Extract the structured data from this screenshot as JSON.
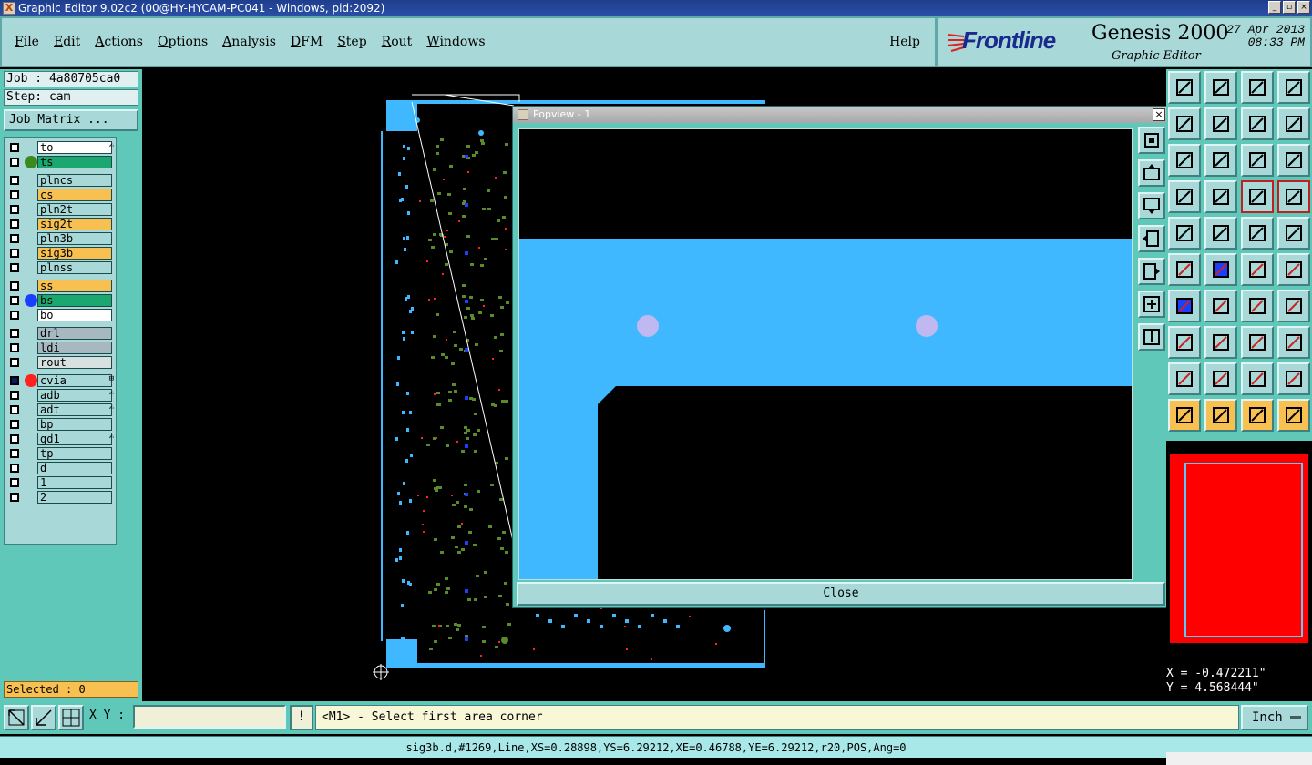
{
  "window": {
    "title": "Graphic Editor 9.02c2 (00@HY-HYCAM-PC041 - Windows, pid:2092)",
    "controls": [
      "_",
      "▫",
      "×"
    ]
  },
  "menu": {
    "items": [
      "File",
      "Edit",
      "Actions",
      "Options",
      "Analysis",
      "DFM",
      "Step",
      "Rout",
      "Windows"
    ],
    "help": "Help"
  },
  "brand": {
    "logo": "Frontline",
    "product": "Genesis 2000",
    "subtitle": "Graphic Editor",
    "date": "27 Apr 2013",
    "time": "08:33 PM"
  },
  "left": {
    "job": "Job : 4a80705ca0",
    "step": "Step: cam",
    "job_matrix": "Job Matrix ...",
    "selected": "Selected : 0",
    "layers": [
      {
        "name": "to",
        "bg": "#ffffff",
        "dot": "",
        "suffix": "✍"
      },
      {
        "name": "ts",
        "bg": "#1aa870",
        "dot": "#3a8a20",
        "suffix": ""
      },
      {
        "name": "plncs",
        "bg": "#a8d8d8",
        "dot": "",
        "suffix": ""
      },
      {
        "name": "cs",
        "bg": "#f8c050",
        "dot": "",
        "suffix": ""
      },
      {
        "name": "pln2t",
        "bg": "#a8d8d8",
        "dot": "",
        "suffix": ""
      },
      {
        "name": "sig2t",
        "bg": "#f8c050",
        "dot": "",
        "suffix": ""
      },
      {
        "name": "pln3b",
        "bg": "#a8d8d8",
        "dot": "",
        "suffix": ""
      },
      {
        "name": "sig3b",
        "bg": "#f8c050",
        "dot": "",
        "suffix": ""
      },
      {
        "name": "plnss",
        "bg": "#a8d8d8",
        "dot": "",
        "suffix": ""
      },
      {
        "name": "ss",
        "bg": "#f8c050",
        "dot": "",
        "suffix": ""
      },
      {
        "name": "bs",
        "bg": "#1aa870",
        "dot": "#1a40ff",
        "suffix": ""
      },
      {
        "name": "bo",
        "bg": "#ffffff",
        "dot": "",
        "suffix": ""
      },
      {
        "name": "drl",
        "bg": "#a8b8c0",
        "dot": "",
        "suffix": ""
      },
      {
        "name": "ldi",
        "bg": "#a8b8c0",
        "dot": "",
        "suffix": ""
      },
      {
        "name": "rout",
        "bg": "#d8e0e0",
        "dot": "",
        "suffix": ""
      },
      {
        "name": "cvia",
        "bg": "#a8d8d8",
        "dot": "#ff2020",
        "suffix": "⊞"
      },
      {
        "name": "adb",
        "bg": "#a8d8d8",
        "dot": "",
        "suffix": "✍"
      },
      {
        "name": "adt",
        "bg": "#a8d8d8",
        "dot": "",
        "suffix": "✍"
      },
      {
        "name": "bp",
        "bg": "#a8d8d8",
        "dot": "",
        "suffix": ""
      },
      {
        "name": "gd1",
        "bg": "#a8d8d8",
        "dot": "",
        "suffix": "✍"
      },
      {
        "name": "tp",
        "bg": "#a8d8d8",
        "dot": "",
        "suffix": ""
      },
      {
        "name": "d",
        "bg": "#a8d8d8",
        "dot": "",
        "suffix": ""
      },
      {
        "name": "1",
        "bg": "#a8d8d8",
        "dot": "",
        "suffix": ""
      },
      {
        "name": "2",
        "bg": "#a8d8d8",
        "dot": "",
        "suffix": ""
      }
    ]
  },
  "popview": {
    "title": "Popview - 1",
    "close_label": "Close",
    "close_x": "×"
  },
  "coords": {
    "x": "X = -0.472211\"",
    "y": "Y = 4.568444\""
  },
  "bottom": {
    "xy_label": "X Y :",
    "xy_value": "",
    "prompt": "<M1> - Select first area corner",
    "units": "Inch",
    "status": "sig3b.d,#1269,Line,XS=0.28898,YS=6.29212,XE=0.46788,YE=6.29212,r20,POS,Ang=0"
  },
  "colors": {
    "teal_bg": "#5fc8b8",
    "panel": "#a8d8d8",
    "copper": "#40b8ff",
    "pad_green": "#5a8a2a",
    "via_red": "#ff2020",
    "drill": "#c0b8f0"
  },
  "icons": {
    "right_toolbar": [
      "zoom-home-icon",
      "zoom-back-icon",
      "home-icon",
      "window-icon",
      "pan-left-icon",
      "pan-right-icon",
      "mirror-icon",
      "snake-icon",
      "fit-icon",
      "zoom-fit-icon",
      "scale-icon",
      "help-icon",
      "tools-icon",
      "grid-icon",
      "layers-red-icon",
      "layers-red2-icon",
      "measure-icon",
      "slash-icon",
      "ruler-icon",
      "dot-icon",
      "net-icon",
      "cross-icon",
      "line-icon",
      "arrow-icon",
      "angle-icon",
      "diagonal-icon",
      "rotate-icon",
      "text-icon",
      "shape-icon",
      "line-split-icon",
      "bracket-icon",
      "blob-icon",
      "triangle-icon",
      "triangle2-icon",
      "triangle3-icon",
      "triangle4-icon",
      "pointer-icon",
      "pointer-box-icon",
      "pointer-hl-icon",
      "route-icon"
    ],
    "popview_side": [
      "zoom-in-icon",
      "up-icon",
      "down-icon",
      "left-icon",
      "right-icon",
      "expand-icon",
      "fit-vertical-icon"
    ]
  }
}
